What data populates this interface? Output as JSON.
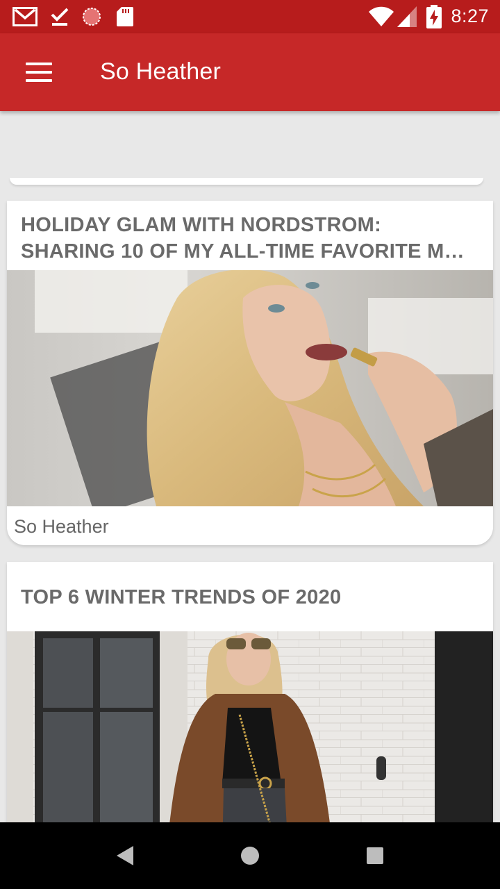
{
  "status_bar": {
    "time": "8:27",
    "icons": [
      "gmail-icon",
      "download-done-icon",
      "sync-icon",
      "sd-card-icon",
      "wifi-icon",
      "cell-signal-icon",
      "battery-charging-icon"
    ]
  },
  "app_bar": {
    "title": "So Heather",
    "menu_icon": "hamburger-menu-icon"
  },
  "posts": [
    {
      "title": "HOLIDAY GLAM WITH NORDSTROM: SHARING 10 OF MY ALL-TIME FAVORITE M…",
      "image": "woman applying lipstick",
      "source": "So Heather"
    },
    {
      "title": "TOP 6 WINTER TRENDS OF 2020",
      "image": "woman in brown teddy coat on street"
    }
  ],
  "nav_bar": {
    "icons": [
      "back-icon",
      "home-icon",
      "recents-icon"
    ]
  },
  "colors": {
    "status_bar": "#b71c1c",
    "app_bar": "#c62828",
    "background": "#e8e8e8"
  }
}
